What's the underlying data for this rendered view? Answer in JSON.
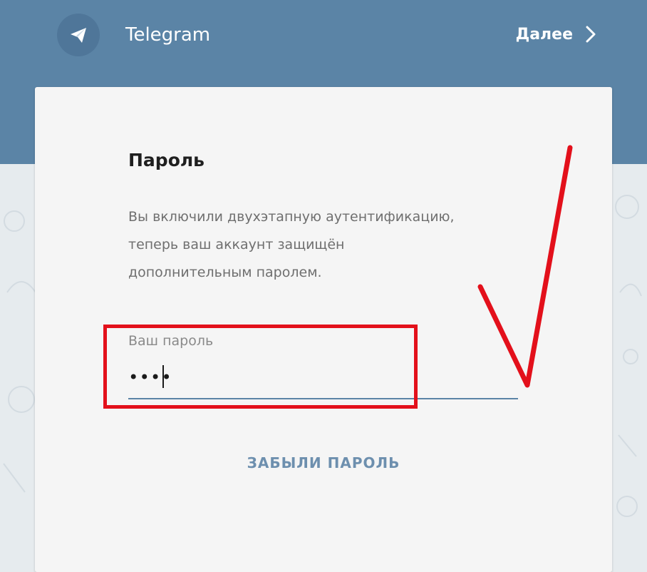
{
  "header": {
    "app_name": "Telegram",
    "next_label": "Далее",
    "logo_icon": "paper-plane-icon",
    "next_icon": "chevron-right-icon"
  },
  "card": {
    "title": "Пароль",
    "description_lines": [
      "Вы включили двухэтапную аутентификацию,",
      "теперь ваш аккаунт защищён",
      "дополнительным паролем."
    ],
    "password_label": "Ваш пароль",
    "password_value": "••••",
    "forgot_label": "ЗАБЫЛИ ПАРОЛЬ"
  },
  "colors": {
    "header_blue": "#5b84a6",
    "link_blue": "#6d8fae",
    "annotation_red": "#e3101b"
  }
}
